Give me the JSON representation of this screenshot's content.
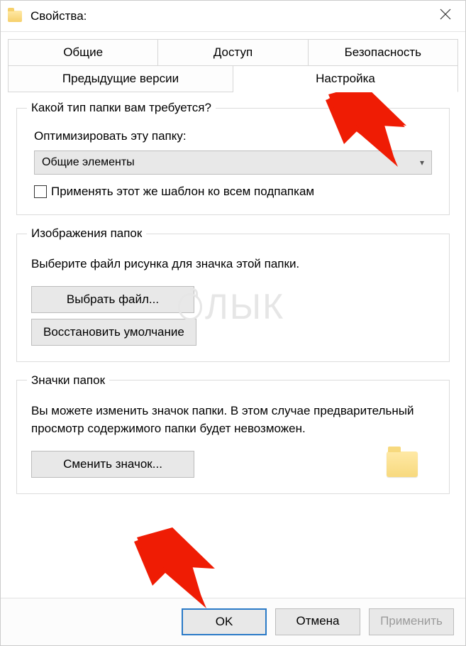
{
  "window": {
    "title": "Свойства:"
  },
  "tabs": {
    "row1": [
      "Общие",
      "Доступ",
      "Безопасность"
    ],
    "row2": [
      "Предыдущие версии",
      "Настройка"
    ],
    "active": "Настройка"
  },
  "group_type": {
    "legend": "Какой тип папки вам требуется?",
    "optimize_label": "Оптимизировать эту папку:",
    "dropdown_value": "Общие элементы",
    "apply_subfolders": "Применять этот же шаблон ко всем подпапкам"
  },
  "group_images": {
    "legend": "Изображения папок",
    "desc": "Выберите файл рисунка для значка этой папки.",
    "choose_file": "Выбрать файл...",
    "restore_default": "Восстановить умолчание"
  },
  "group_icons": {
    "legend": "Значки папок",
    "desc": "Вы можете изменить значок папки. В этом случае предварительный просмотр содержимого папки будет невозможен.",
    "change_icon": "Сменить значок..."
  },
  "buttons": {
    "ok": "OK",
    "cancel": "Отмена",
    "apply": "Применить"
  },
  "watermark": "ЛЫК"
}
